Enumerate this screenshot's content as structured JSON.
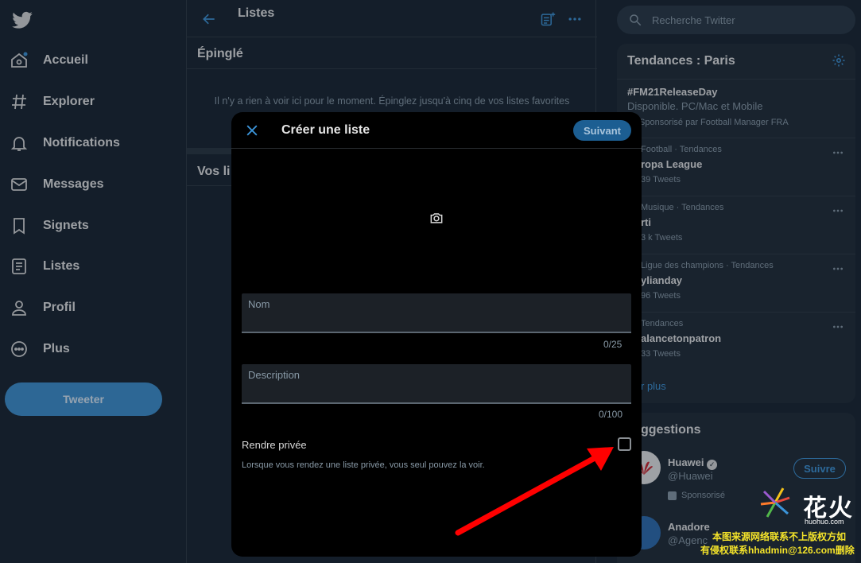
{
  "nav": {
    "items": [
      {
        "label": "Accueil",
        "icon": "home-icon"
      },
      {
        "label": "Explorer",
        "icon": "hashtag-icon"
      },
      {
        "label": "Notifications",
        "icon": "bell-icon"
      },
      {
        "label": "Messages",
        "icon": "envelope-icon"
      },
      {
        "label": "Signets",
        "icon": "bookmark-icon"
      },
      {
        "label": "Listes",
        "icon": "list-icon"
      },
      {
        "label": "Profil",
        "icon": "person-icon"
      },
      {
        "label": "Plus",
        "icon": "more-circle-icon"
      }
    ],
    "tweet_button": "Tweeter"
  },
  "center": {
    "title": "Listes",
    "pinned_title": "Épinglé",
    "pinned_empty": "Il n'y a rien à voir ici pour le moment. Épinglez jusqu'à cinq de vos listes favorites",
    "yours_title": "Vos li"
  },
  "search": {
    "placeholder": "Recherche Twitter"
  },
  "trends": {
    "title": "Tendances : Paris",
    "promoted": {
      "name": "#FM21ReleaseDay",
      "desc": "Disponible. PC/Mac et Mobile",
      "sponsor": "Sponsorisé par Football Manager FRA"
    },
    "items": [
      {
        "meta": "Football · Tendances",
        "name": "ropa League",
        "count": "39 Tweets"
      },
      {
        "meta": "Musique · Tendances",
        "name": "rti",
        "count": "3 k Tweets"
      },
      {
        "meta": "Ligue des champions · Tendances",
        "name": "ylianday",
        "count": "96 Tweets"
      },
      {
        "meta": "Tendances",
        "name": "alancetonpatron",
        "count": "33 Tweets"
      }
    ],
    "show_more": "r plus"
  },
  "suggestions": {
    "title": "ggestions",
    "accounts": [
      {
        "name": "Huawei",
        "handle": "@Huawei",
        "promo": "Sponsorisé",
        "follow": "Suivre"
      },
      {
        "name": "Anadore",
        "handle": "@Agenc"
      }
    ]
  },
  "modal": {
    "title": "Créer une liste",
    "next_button": "Suivant",
    "name_label": "Nom",
    "name_value": "",
    "name_counter": "0/25",
    "desc_label": "Description",
    "desc_value": "",
    "desc_counter": "0/100",
    "private_label": "Rendre privée",
    "private_help": "Lorsque vous rendez une liste privée, vous seul pouvez la voir.",
    "private_checked": false
  },
  "watermark": {
    "brand": "花火",
    "site": "huohuo.com",
    "note_line1": "本图来源网络联系不上版权方如",
    "note_line2": "有侵权联系hhadmin@126.com删除"
  },
  "colors": {
    "background": "#15202b",
    "accent": "#3b94d9",
    "tweet_button": "#3b8fd0",
    "modal_bg": "#000000",
    "annotation_arrow": "#ff0000"
  }
}
